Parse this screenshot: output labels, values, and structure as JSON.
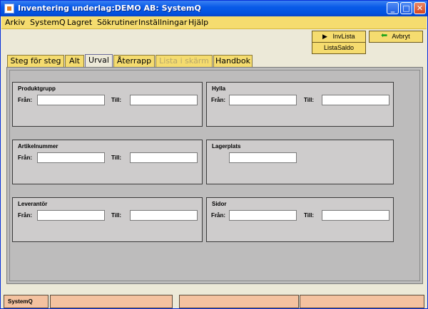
{
  "window": {
    "title": "Inventering underlag:DEMO AB: SystemQ",
    "minimize_glyph": "_",
    "maximize_glyph": "□",
    "close_glyph": "✕"
  },
  "menu": [
    "Arkiv",
    "SystemQ",
    "Lagret",
    "Sökrutiner",
    "Inställningar",
    "Hjälp"
  ],
  "toolbar": {
    "invlista": "InvLista",
    "avbryt": "Avbryt",
    "listasaldo": "ListaSaldo",
    "invlista_icon": "play-arrow-icon",
    "avbryt_icon": "green-back-arrow-icon",
    "play_glyph": "▶",
    "back_glyph": "⬅"
  },
  "tabs": [
    {
      "label": "Steg för steg",
      "state": "normal"
    },
    {
      "label": "Alt",
      "state": "normal"
    },
    {
      "label": "Urval",
      "state": "active"
    },
    {
      "label": "Återrapp",
      "state": "normal"
    },
    {
      "label": "Lista i skärm",
      "state": "disabled"
    },
    {
      "label": "Handbok",
      "state": "normal"
    }
  ],
  "groups": {
    "produktgrupp": {
      "title": "Produktgrupp",
      "from_label": "Från:",
      "to_label": "Till:",
      "from_value": "",
      "to_value": ""
    },
    "hylla": {
      "title": "Hylla",
      "from_label": "Från:",
      "to_label": "Till:",
      "from_value": "",
      "to_value": ""
    },
    "artikelnummer": {
      "title": "Artikelnummer",
      "from_label": "Från:",
      "to_label": "Till:",
      "from_value": "",
      "to_value": ""
    },
    "lagerplats": {
      "title": "Lagerplats",
      "value": ""
    },
    "leverantor": {
      "title": "Leverantör",
      "from_label": "Från:",
      "to_label": "Till:",
      "from_value": "",
      "to_value": ""
    },
    "sidor": {
      "title": "Sidor",
      "from_label": "Från:",
      "to_label": "Till:",
      "from_value": "",
      "to_value": ""
    }
  },
  "status": [
    "SystemQ",
    "",
    "",
    "",
    ""
  ],
  "colors": {
    "title_bar": "#0A5BE8",
    "menu_bg": "#F5DC6F",
    "tab_bg": "#F5DC6F",
    "panel_bg": "#BCBCBC",
    "group_bg": "#CECCCC",
    "status_bg": "#F4C2A0",
    "back_arrow": "#1BA31B"
  }
}
